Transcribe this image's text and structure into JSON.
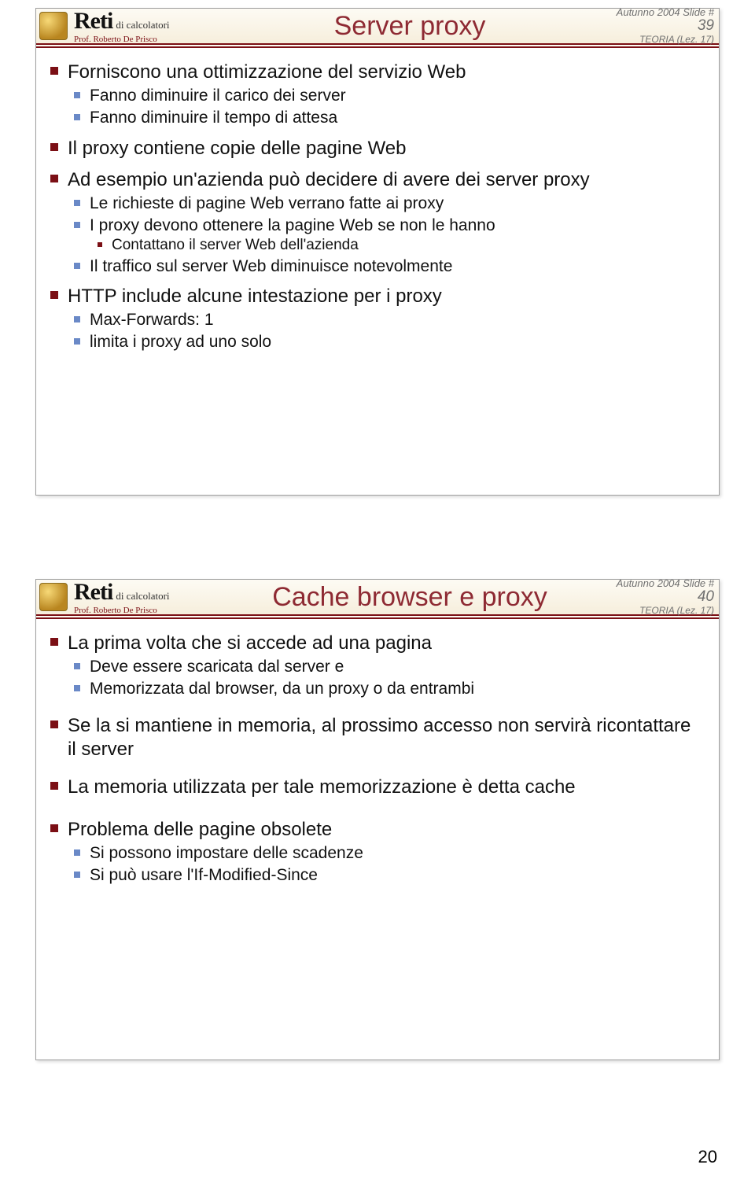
{
  "brand": {
    "name": "Reti",
    "sub": "di calcolatori",
    "prof": "Prof. Roberto De Prisco"
  },
  "slide1": {
    "title": "Server proxy",
    "meta_term": "Autunno 2004 Slide #",
    "meta_num": "39",
    "meta_line2": "TEORIA (Lez. 17)",
    "b1": "Forniscono una ottimizzazione del servizio Web",
    "b1a": "Fanno diminuire il carico dei server",
    "b1b": "Fanno diminuire il tempo di attesa",
    "b2": "Il proxy contiene copie delle pagine Web",
    "b3": "Ad esempio un'azienda può decidere di avere dei server proxy",
    "b3a": "Le richieste di pagine Web verrano fatte ai proxy",
    "b3b": "I proxy devono ottenere la pagine Web se non le hanno",
    "b3b1": "Contattano il server Web dell'azienda",
    "b3c": "Il traffico sul server Web diminuisce notevolmente",
    "b4": "HTTP include alcune intestazione per i proxy",
    "b4a": "Max-Forwards: 1",
    "b4b": "limita i proxy ad uno solo"
  },
  "slide2": {
    "title": "Cache browser e proxy",
    "meta_term": "Autunno 2004 Slide #",
    "meta_num": "40",
    "meta_line2": "TEORIA (Lez. 17)",
    "b1": "La prima volta che si accede ad una pagina",
    "b1a": "Deve essere scaricata dal server e",
    "b1b": "Memorizzata dal browser, da un proxy o da entrambi",
    "b2": "Se la si mantiene in memoria, al prossimo accesso non servirà ricontattare il server",
    "b3": "La memoria utilizzata per tale memorizzazione è detta cache",
    "b4": "Problema delle pagine obsolete",
    "b4a": "Si possono impostare delle scadenze",
    "b4b": "Si può usare l'If-Modified-Since"
  },
  "page_number": "20"
}
